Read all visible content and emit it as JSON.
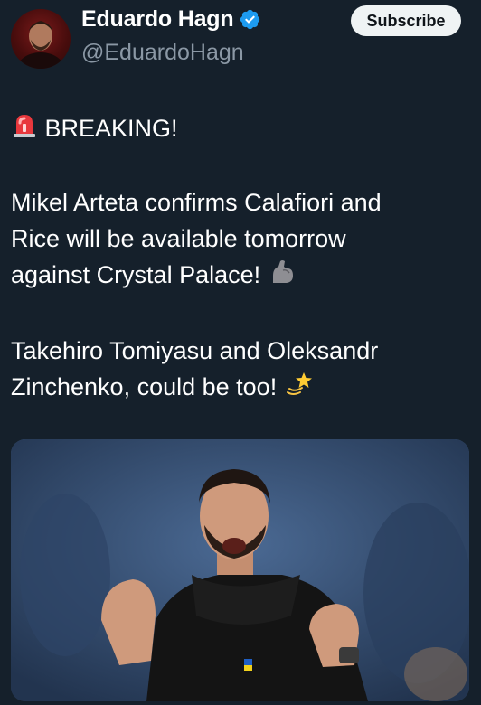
{
  "author": {
    "name": "Eduardo Hagn",
    "handle": "@EduardoHagn",
    "verified": true,
    "verified_color": "#1d9bf0"
  },
  "header": {
    "subscribe_label": "Subscribe"
  },
  "tweet": {
    "lines": [
      "BREAKING!",
      "Mikel Arteta confirms Calafiori and",
      "Rice will be available tomorrow",
      "against Crystal Palace!",
      "Takehiro Tomiyasu and Oleksandr",
      "Zinchenko, could be too!"
    ],
    "icons": {
      "breaking": "rotating-light-icon",
      "strong": "flexed-biceps-icon",
      "dizzy": "dizzy-icon"
    }
  },
  "media": {
    "type": "photo"
  },
  "colors": {
    "background": "#15202b",
    "text": "#ffffff",
    "secondary_text": "#8b98a5",
    "button_bg": "#eff3f4"
  }
}
